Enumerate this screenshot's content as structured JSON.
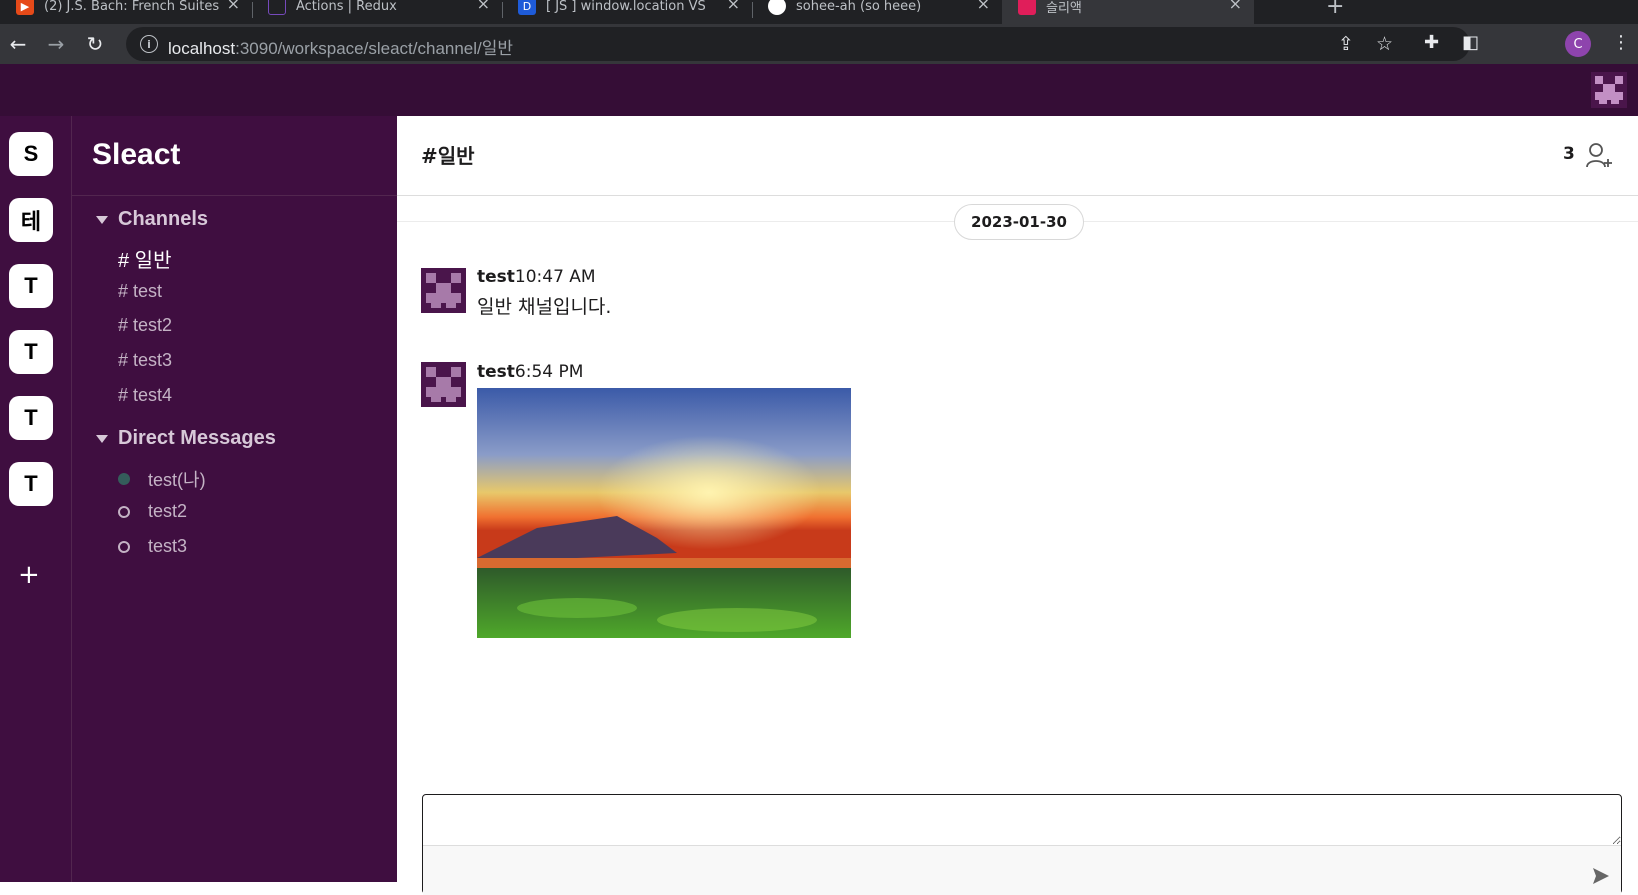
{
  "browser": {
    "tabs": [
      {
        "title": "(2) J.S. Bach: French Suites",
        "icon_color": "#e64a19"
      },
      {
        "title": "Actions | Redux",
        "icon_color": "#764abc"
      },
      {
        "title": "[ JS ] window.location VS",
        "icon_color": "#1e5bd8",
        "icon_letter": "D"
      },
      {
        "title": "sohee-ah (so heee)",
        "icon_color": "#ffffff"
      },
      {
        "title": "슬리액",
        "icon_color": "#e01e5a"
      }
    ],
    "url_host": "localhost",
    "url_path": ":3090/workspace/sleact/channel/일반",
    "profile_initial": "C"
  },
  "workspaces": [
    {
      "initial": "S"
    },
    {
      "initial": "테"
    },
    {
      "initial": "T"
    },
    {
      "initial": "T"
    },
    {
      "initial": "T"
    },
    {
      "initial": "T"
    }
  ],
  "workspace_add": "+",
  "sidebar": {
    "workspace_name": "Sleact",
    "channels_title": "Channels",
    "channels": [
      {
        "label": "# 일반"
      },
      {
        "label": "# test"
      },
      {
        "label": "# test2"
      },
      {
        "label": "# test3"
      },
      {
        "label": "# test4"
      }
    ],
    "dm_title": "Direct Messages",
    "dms": [
      {
        "label": "test(나)",
        "online": true
      },
      {
        "label": "test2",
        "online": false
      },
      {
        "label": "test3",
        "online": false
      }
    ]
  },
  "chat": {
    "title": "#일반",
    "member_count": "3",
    "date": "2023-01-30",
    "messages": [
      {
        "user": "test",
        "time": "10:47 AM",
        "text": "일반 채널입니다."
      },
      {
        "user": "test",
        "time": "6:54 PM",
        "text": ""
      }
    ],
    "composer_placeholder": ""
  },
  "colors": {
    "header": "#350d36",
    "sidebar": "#3f0e40",
    "accent_avatar": "#4a154b"
  }
}
